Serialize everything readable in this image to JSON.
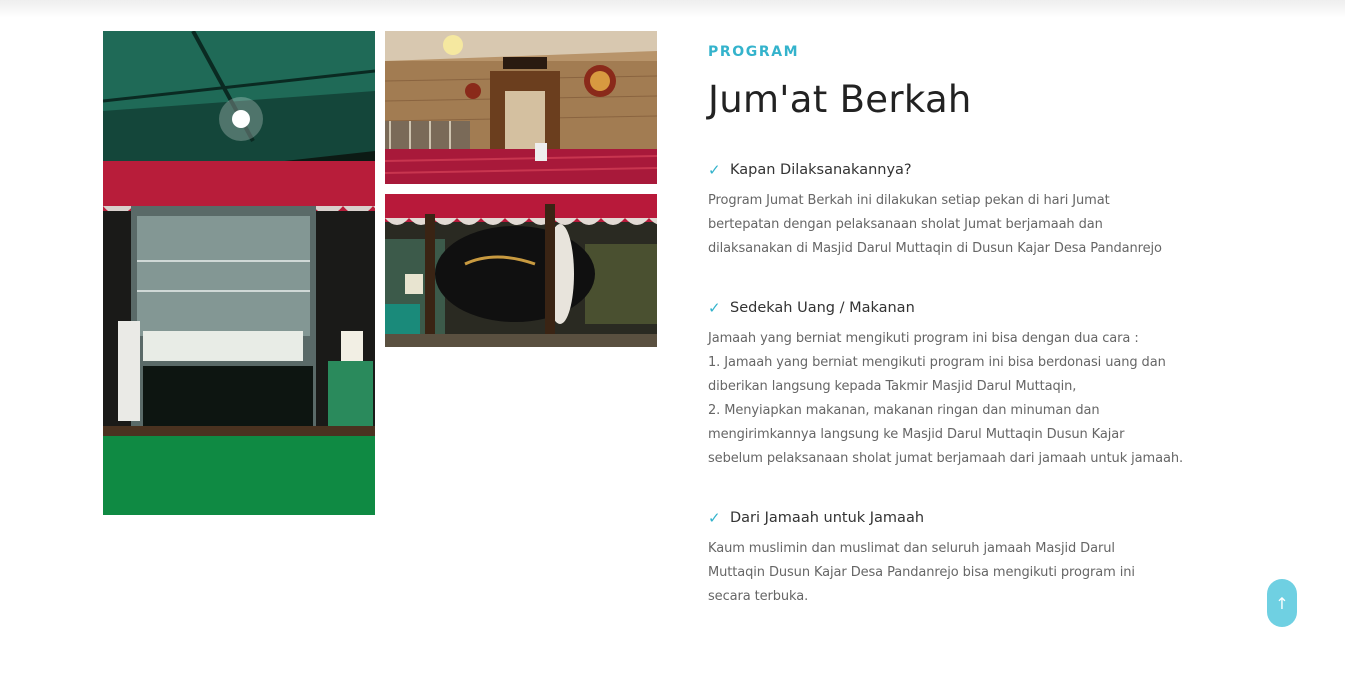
{
  "section": {
    "eyebrow": "PROGRAM",
    "title": "Jum'at Berkah"
  },
  "items": [
    {
      "heading": "Kapan Dilaksanakannya?",
      "lines": [
        "Program Jumat Berkah ini dilakukan setiap pekan di hari Jumat",
        "bertepatan dengan pelaksanaan sholat Jumat berjamaah dan",
        "dilaksanakan di Masjid Darul Muttaqin di Dusun Kajar Desa Pandanrejo"
      ]
    },
    {
      "heading": "Sedekah Uang / Makanan",
      "lines": [
        "Jamaah yang berniat mengikuti program ini bisa dengan dua cara :",
        "1. Jamaah yang berniat mengikuti program ini bisa berdonasi uang dan",
        "diberikan langsung kepada Takmir Masjid Darul Muttaqin,",
        "2. Menyiapkan makanan, makanan ringan dan minuman dan",
        "mengirimkannya langsung ke Masjid Darul Muttaqin Dusun Kajar",
        "sebelum pelaksanaan sholat jumat berjamaah dari jamaah untuk jamaah."
      ]
    },
    {
      "heading": "Dari Jamaah untuk Jamaah",
      "lines": [
        "Kaum muslimin dan muslimat dan seluruh jamaah Masjid Darul",
        "Muttaqin Dusun Kajar Desa Pandanrejo bisa mengikuti program ini",
        "secara terbuka."
      ]
    }
  ],
  "icons": {
    "check": "check-icon",
    "back_to_top": "arrow-up-icon"
  },
  "colors": {
    "accent": "#34b3cc",
    "back_to_top": "#6fd0e2",
    "title": "#222222",
    "body_text": "#666666"
  }
}
